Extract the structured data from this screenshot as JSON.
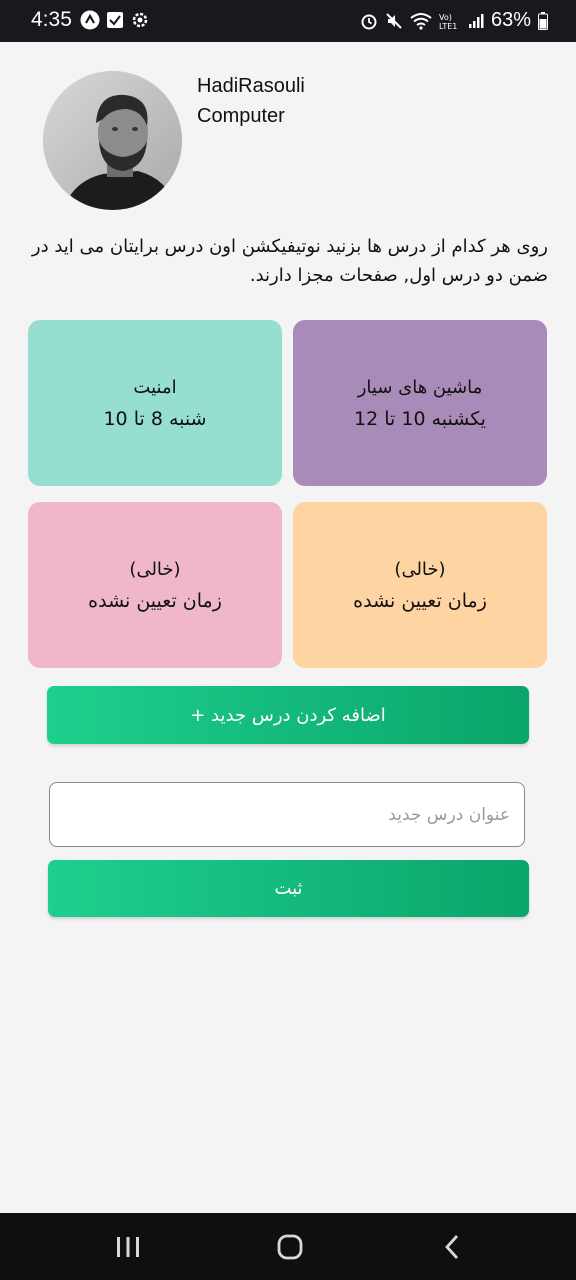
{
  "status_bar": {
    "time": "4:35",
    "battery": "63%",
    "icons_left": [
      "app-icon",
      "check-icon",
      "gear-icon"
    ],
    "icons_right": [
      "alarm-icon",
      "mute-icon",
      "wifi-icon",
      "volte-icon",
      "signal-icon",
      "battery-icon"
    ]
  },
  "profile": {
    "name": "HadiRasouli",
    "department": "Computer"
  },
  "instructions": "روی هر کدام از درس ها بزنید نوتیفیکشن اون درس برایتان می اید در ضمن دو درس اول, صفحات مجزا دارند.",
  "courses": [
    {
      "title": "ماشین های سیار",
      "time": "یکشنبه 10 تا 12",
      "color": "#a88bb9"
    },
    {
      "title": "امنیت",
      "time": "شنبه 8 تا 10",
      "color": "#96dfd0"
    },
    {
      "title": "(خالی)",
      "time": "زمان تعیین نشده",
      "color": "#fed5a2"
    },
    {
      "title": "(خالی)",
      "time": "زمان تعیین نشده",
      "color": "#efb7c8"
    }
  ],
  "add_button_label": "اضافه کردن درس جدید +",
  "new_course_input": {
    "placeholder": "عنوان درس جدید",
    "value": ""
  },
  "submit_label": "ثبت",
  "colors": {
    "accent": "#12bd7c",
    "background": "#f4f4f4"
  },
  "nav_bar": [
    "recent-apps-icon",
    "home-icon",
    "back-icon"
  ]
}
